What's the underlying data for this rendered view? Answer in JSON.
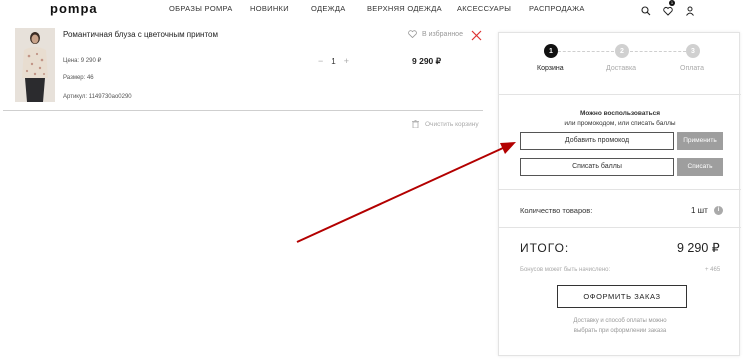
{
  "header": {
    "logo": "pompa",
    "nav": [
      "ОБРАЗЫ POMPA",
      "НОВИНКИ",
      "ОДЕЖДА",
      "ВЕРХНЯЯ ОДЕЖДА",
      "АКСЕССУАРЫ",
      "РАСПРОДАЖА"
    ],
    "cart_badge": "1",
    "icons": [
      "search-icon",
      "heart-icon",
      "user-icon"
    ]
  },
  "cart": {
    "item": {
      "title": "Романтичная блуза с цветочным принтом",
      "price_line": "Цена: 9 290 ₽",
      "size_line": "Размер: 46",
      "article_line": "Артикул: 1149730ao0290",
      "quantity": "1",
      "qty_minus": "−",
      "qty_plus": "+",
      "total": "9 290 ₽",
      "favorite_label": "В избранное"
    },
    "clear_label": "Очистить корзину"
  },
  "summary": {
    "steps": [
      {
        "num": "1",
        "label": "Корзина"
      },
      {
        "num": "2",
        "label": "Доставка"
      },
      {
        "num": "3",
        "label": "Оплата"
      }
    ],
    "promo_text_1": "Можно воспользоваться",
    "promo_text_2": "или промокодом, или списать баллы",
    "add_promo": "Добавить промокод",
    "apply": "Применить",
    "use_points": "Списать баллы",
    "write_off": "Списать",
    "count_label": "Количество товаров:",
    "count_value": "1 шт",
    "info": "i",
    "total_label": "ИТОГО:",
    "total_value": "9 290 ₽",
    "bonus_label": "Бонусов может быть начислено:",
    "bonus_value": "+ 465",
    "checkout": "ОФОРМИТЬ ЗАКАЗ",
    "delivery_note_1": "Доставку и способ оплаты можно",
    "delivery_note_2": "выбрать при оформлении заказа"
  },
  "colors": {
    "accent_dark": "#111111",
    "step_inactive": "#d0d0d0",
    "button_gray": "#9e9e9e",
    "annotation_arrow": "#b30000",
    "remove_x": "#d33"
  }
}
